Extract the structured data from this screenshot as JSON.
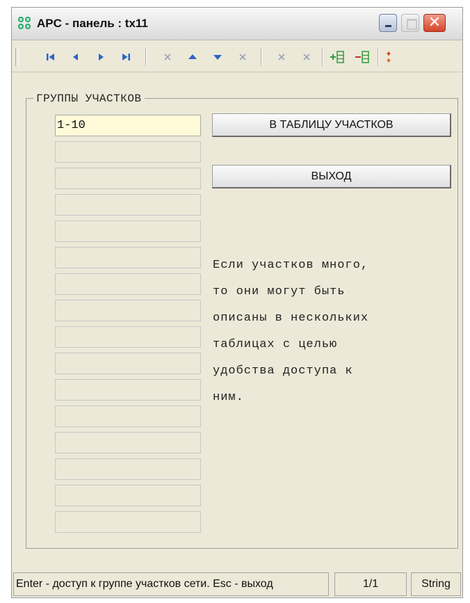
{
  "window": {
    "title": "APC -  панель : tx11",
    "close_glyph": "✕"
  },
  "toolbar": {
    "buttons": [
      {
        "icon": "first-record-icon"
      },
      {
        "icon": "prev-record-icon"
      },
      {
        "icon": "next-record-icon"
      },
      {
        "icon": "last-record-icon"
      },
      {
        "icon": "cancel-x-icon"
      },
      {
        "icon": "move-up-icon"
      },
      {
        "icon": "move-down-icon"
      },
      {
        "icon": "cancel-x-icon"
      },
      {
        "icon": "cancel-x-icon"
      },
      {
        "icon": "cancel-x-icon"
      },
      {
        "icon": "add-row-icon"
      },
      {
        "icon": "remove-row-icon"
      },
      {
        "icon": "refresh-icon"
      }
    ]
  },
  "groups": {
    "legend": "ГРУППЫ УЧАСТКОВ",
    "fields": [
      "1-10",
      "",
      "",
      "",
      "",
      "",
      "",
      "",
      "",
      "",
      "",
      "",
      "",
      "",
      "",
      ""
    ]
  },
  "actions": {
    "to_table_label": "В ТАБЛИЦУ УЧАСТКОВ",
    "exit_label": "ВЫХОД"
  },
  "info_text": "Если участков много,\nто они могут быть\nописаны в нескольких\nтаблицах с целью\nудобства доступа к\nним.",
  "status": {
    "hint": "Enter - доступ к группе участков сети.  Esc - выход",
    "position": "1/1",
    "type": "String"
  },
  "colors": {
    "toolbar_nav": "#2c64c8",
    "toolbar_disabled": "#9aa3b8",
    "toolbar_add": "#2e9a3c",
    "toolbar_remove": "#c83030",
    "active_field": "#fffad8"
  }
}
